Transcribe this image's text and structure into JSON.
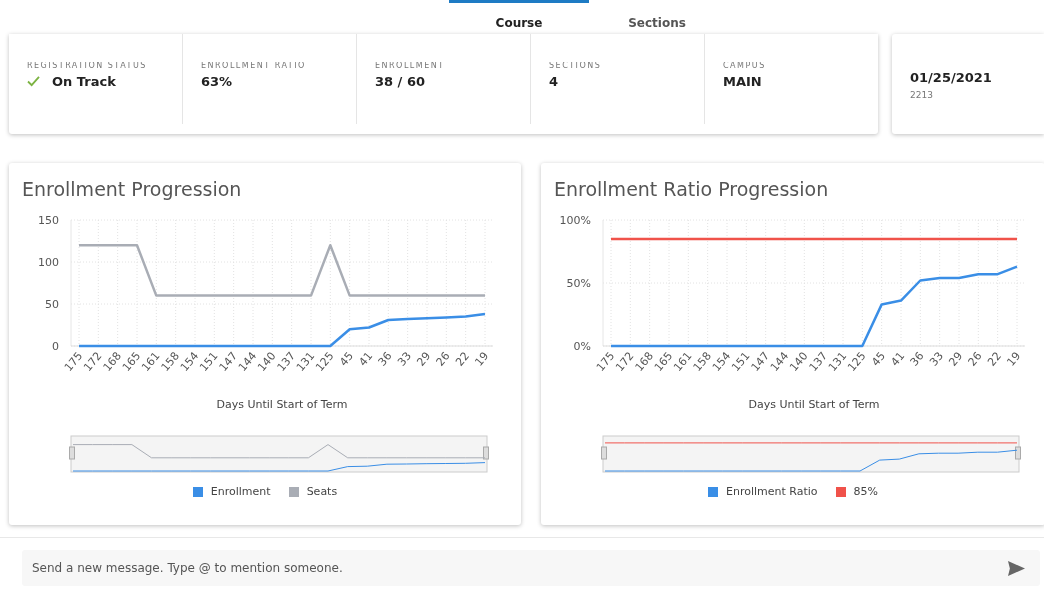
{
  "tabs": [
    {
      "label": "Course",
      "selected": true
    },
    {
      "label": "Sections",
      "selected": false
    }
  ],
  "summary": {
    "items": [
      {
        "label": "REGISTRATION STATUS",
        "value": "On Track",
        "kind": "status"
      },
      {
        "label": "ENROLLMENT RATIO",
        "value": "63%",
        "kind": "plain"
      },
      {
        "label": "ENROLLMENT",
        "value": "38 / 60",
        "kind": "plain"
      },
      {
        "label": "SECTIONS",
        "value": "4",
        "kind": "plain"
      },
      {
        "label": "CAMPUS",
        "value": "MAIN",
        "kind": "plain"
      }
    ]
  },
  "date_card": {
    "date": "01/25/2021",
    "code": "2213"
  },
  "charts": [
    {
      "title": "Enrollment Progression",
      "chart_data": {
        "type": "line",
        "xlabel": "Days Until Start of Term",
        "categories": [
          "175",
          "172",
          "168",
          "165",
          "161",
          "158",
          "154",
          "151",
          "147",
          "144",
          "140",
          "137",
          "131",
          "125",
          "45",
          "41",
          "36",
          "33",
          "29",
          "26",
          "22",
          "19"
        ],
        "series": [
          {
            "name": "Enrollment",
            "color": "#3a8ee6",
            "values": [
              0,
              0,
              0,
              0,
              0,
              0,
              0,
              0,
              0,
              0,
              0,
              0,
              0,
              0,
              20,
              22,
              31,
              32,
              33,
              34,
              35,
              38
            ]
          },
          {
            "name": "Seats",
            "color": "#a9adb5",
            "values": [
              120,
              120,
              120,
              120,
              60,
              60,
              60,
              60,
              60,
              60,
              60,
              60,
              60,
              120,
              60,
              60,
              60,
              60,
              60,
              60,
              60,
              60
            ]
          }
        ],
        "grid": true,
        "ylim": [
          0,
          150
        ],
        "yticks": [
          {
            "value": 0,
            "label": "0"
          },
          {
            "value": 50,
            "label": "50"
          },
          {
            "value": 100,
            "label": "100"
          },
          {
            "value": 150,
            "label": "150"
          }
        ]
      }
    },
    {
      "title": "Enrollment Ratio Progression",
      "chart_data": {
        "type": "line",
        "xlabel": "Days Until Start of Term",
        "categories": [
          "175",
          "172",
          "168",
          "165",
          "161",
          "158",
          "154",
          "151",
          "147",
          "144",
          "140",
          "137",
          "131",
          "125",
          "45",
          "41",
          "36",
          "33",
          "29",
          "26",
          "22",
          "19"
        ],
        "series": [
          {
            "name": "Enrollment Ratio",
            "color": "#3a8ee6",
            "values": [
              0,
              0,
              0,
              0,
              0,
              0,
              0,
              0,
              0,
              0,
              0,
              0,
              0,
              0,
              33,
              36,
              52,
              54,
              54,
              57,
              57,
              63
            ]
          },
          {
            "name": "85%",
            "color": "#f0524a",
            "values": [
              85,
              85,
              85,
              85,
              85,
              85,
              85,
              85,
              85,
              85,
              85,
              85,
              85,
              85,
              85,
              85,
              85,
              85,
              85,
              85,
              85,
              85
            ]
          }
        ],
        "grid": true,
        "ylim": [
          0,
          100
        ],
        "yticks": [
          {
            "value": 0,
            "label": "0%"
          },
          {
            "value": 50,
            "label": "50%"
          },
          {
            "value": 100,
            "label": "100%"
          }
        ]
      }
    }
  ],
  "message": {
    "placeholder": "Send a new message. Type @ to mention someone."
  }
}
